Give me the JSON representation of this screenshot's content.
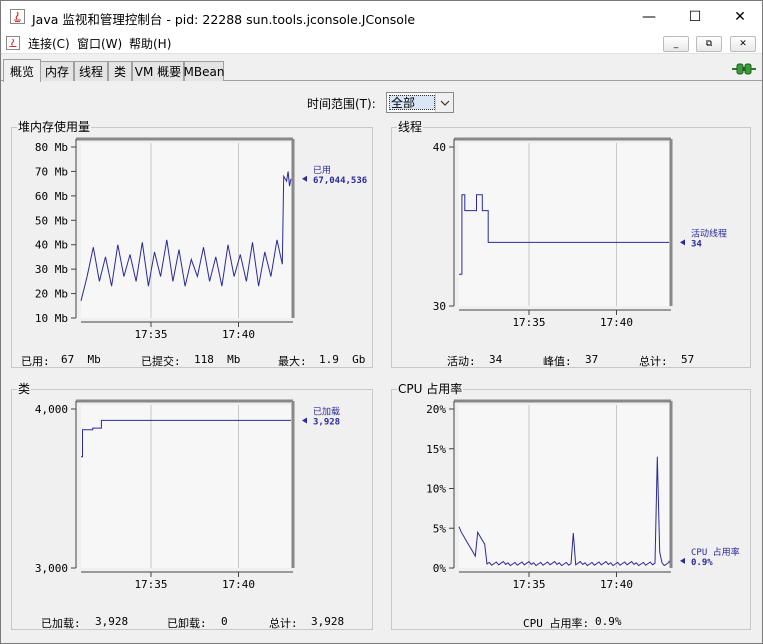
{
  "window": {
    "title": "Java 监视和管理控制台 - pid: 22288 sun.tools.jconsole.JConsole",
    "minimize": "—",
    "maximize": "☐",
    "close": "✕"
  },
  "menu": {
    "items": [
      "连接(C)",
      "窗口(W)",
      "帮助(H)"
    ],
    "mdi_min": "_",
    "mdi_restore": "⧉",
    "mdi_close": "✕"
  },
  "tabs": [
    "概览",
    "内存",
    "线程",
    "类",
    "VM 概要",
    "MBean"
  ],
  "active_tab": 0,
  "time_range": {
    "label": "时间范围(T):",
    "value": "全部"
  },
  "x_ticks": [
    "17:35",
    "17:40"
  ],
  "panels": {
    "heap": {
      "title": "堆内存使用量",
      "y_ticks": [
        "80 Mb",
        "70 Mb",
        "60 Mb",
        "50 Mb",
        "40 Mb",
        "30 Mb",
        "20 Mb",
        "10 Mb"
      ],
      "legend_name": "已用",
      "legend_value": "67,044,536",
      "footer": {
        "used_label": "已用:",
        "used": "67  Mb",
        "committed_label": "已提交:",
        "committed": "118  Mb",
        "max_label": "最大:",
        "max": "1.9  Gb"
      }
    },
    "threads": {
      "title": "线程",
      "y_ticks": [
        "40",
        "30"
      ],
      "legend_name": "活动线程",
      "legend_value": "34",
      "footer": {
        "live_label": "活动:",
        "live": "34",
        "peak_label": "峰值:",
        "peak": "37",
        "total_label": "总计:",
        "total": "57"
      }
    },
    "classes": {
      "title": "类",
      "y_ticks": [
        "4,000",
        "3,000"
      ],
      "legend_name": "已加载",
      "legend_value": "3,928",
      "footer": {
        "loaded_label": "已加载:",
        "loaded": "3,928",
        "unloaded_label": "已卸载:",
        "unloaded": "0",
        "total_label": "总计:",
        "total": "3,928"
      }
    },
    "cpu": {
      "title": "CPU 占用率",
      "y_ticks": [
        "20%",
        "15%",
        "10%",
        "5%",
        "0%"
      ],
      "legend_name": "CPU 占用率",
      "legend_value": "0.9%",
      "footer": {
        "label": "CPU 占用率:",
        "value": "0.9%"
      }
    }
  },
  "colors": {
    "series": "#2a2a9a",
    "plot_bg": "#f7f7f7",
    "grid": "#c8c8c8",
    "panel_bg": "#f0f0f0"
  },
  "chart_data": [
    {
      "type": "line",
      "title": "堆内存使用量",
      "ylabel": "Mb",
      "ylim": [
        10,
        80
      ],
      "xlim": [
        "17:31",
        "17:43"
      ],
      "series": [
        {
          "name": "已用",
          "values_desc": "sawtooth 17-40 Mb then jump to ~67-70 Mb at end",
          "x": [
            "17:31",
            "17:33",
            "17:35",
            "17:37",
            "17:39",
            "17:42",
            "17:42:30",
            "17:43"
          ],
          "y": [
            17,
            40,
            35,
            38,
            35,
            32,
            68,
            67
          ]
        }
      ]
    },
    {
      "type": "line",
      "title": "线程",
      "ylim": [
        30,
        40
      ],
      "xlim": [
        "17:31",
        "17:43"
      ],
      "series": [
        {
          "name": "活动线程",
          "x": [
            "17:31",
            "17:31:10",
            "17:31:20",
            "17:31:50",
            "17:32",
            "17:32:20",
            "17:32:40",
            "17:43"
          ],
          "y": [
            32,
            37,
            36,
            36,
            37,
            36,
            34,
            34
          ]
        }
      ]
    },
    {
      "type": "line",
      "title": "类",
      "ylim": [
        3000,
        4000
      ],
      "xlim": [
        "17:31",
        "17:43"
      ],
      "series": [
        {
          "name": "已加载",
          "x": [
            "17:31",
            "17:31:05",
            "17:31:40",
            "17:32:10",
            "17:43"
          ],
          "y": [
            3700,
            3870,
            3880,
            3928,
            3928
          ]
        }
      ]
    },
    {
      "type": "line",
      "title": "CPU 占用率",
      "ylim": [
        0,
        20
      ],
      "xlim": [
        "17:31",
        "17:43"
      ],
      "series": [
        {
          "name": "CPU 占用率",
          "x": [
            "17:31",
            "17:31:30",
            "17:32",
            "17:33",
            "17:36",
            "17:37:30",
            "17:40",
            "17:42:20",
            "17:42:40",
            "17:43"
          ],
          "y": [
            5.2,
            2.5,
            1.8,
            0.6,
            0.5,
            4.4,
            0.5,
            14.0,
            2.0,
            0.9
          ]
        }
      ]
    }
  ]
}
